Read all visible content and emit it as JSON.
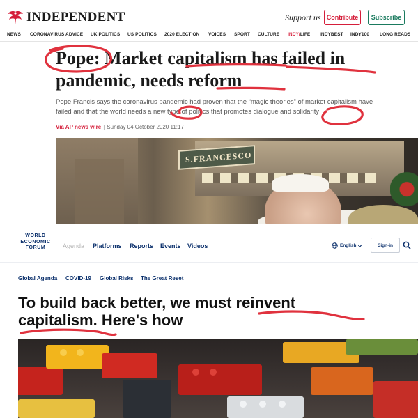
{
  "independent": {
    "logo_text": "INDEPENDENT",
    "support_text": "Support us",
    "contribute_label": "Contribute",
    "subscribe_label": "Subscribe",
    "nav": [
      "NEWS",
      "CORONAVIRUS ADVICE",
      "UK POLITICS",
      "US POLITICS",
      "2020 ELECTION",
      "VOICES",
      "SPORT",
      "CULTURE",
      "INDY/",
      "LIFE",
      "INDYBEST",
      "INDY100",
      "LONG READS"
    ],
    "headline_part1": "Pope:",
    "headline_part2": " Market capitalism has failed in pandemic, needs reform",
    "standfirst_line1": "Pope Francis says the coronavirus pandemic had proven that the “magic theories” of market capitalism have",
    "standfirst_line2": "failed and that the world needs a new type of politics that promotes dialogue and solidarity",
    "byline_source": "Via AP news wire",
    "byline_date": "Sunday 04 October 2020 11:17",
    "photo_sign_text": "S.FRANCESCO",
    "accent_color": "#d51e3a",
    "subscribe_color": "#1a7a5e"
  },
  "wef": {
    "logo_lines": [
      "WORLD",
      "ECONOMIC",
      "FORUM"
    ],
    "nav": [
      "Agenda",
      "Platforms",
      "Reports",
      "Events",
      "Videos"
    ],
    "language": "English",
    "signin_label": "Sign-in",
    "topics": [
      "Global Agenda",
      "COVID-19",
      "Global Risks",
      "The Great Reset"
    ],
    "headline_line1": "To build back better, we must reinvent",
    "headline_line2": "capitalism. Here's how",
    "brand_color": "#0a2f6b"
  },
  "annotation_color": "#e0323e",
  "icons": [
    "eagle-icon",
    "globe-icon",
    "chevron-down-icon",
    "search-icon"
  ]
}
